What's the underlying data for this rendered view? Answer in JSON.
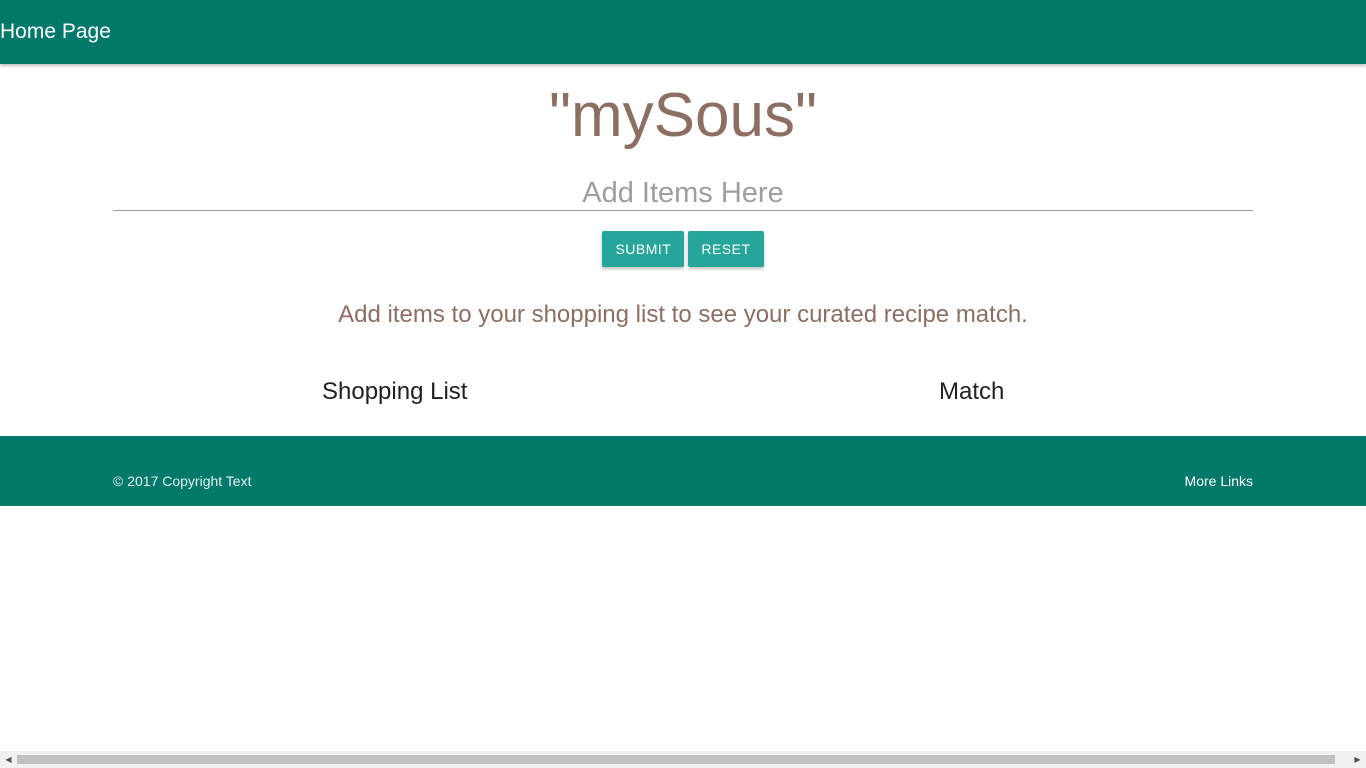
{
  "navbar": {
    "brand": "Home Page",
    "color": "#00796b"
  },
  "main": {
    "title": "\"mySous\"",
    "input_placeholder": "Add Items Here",
    "input_value": "",
    "submit_label": "SUBMIT",
    "reset_label": "RESET",
    "hint": "Add items to your shopping list to see your curated recipe match.",
    "shopping_list_heading": "Shopping List",
    "match_heading": "Match",
    "accent_color": "#8d6e63",
    "button_color": "#26a69a"
  },
  "footer": {
    "copyright": "© 2017 Copyright Text",
    "links_label": "More Links"
  },
  "scrollbar": {
    "left_icon": "chevron-left-icon",
    "right_icon": "chevron-right-icon"
  }
}
